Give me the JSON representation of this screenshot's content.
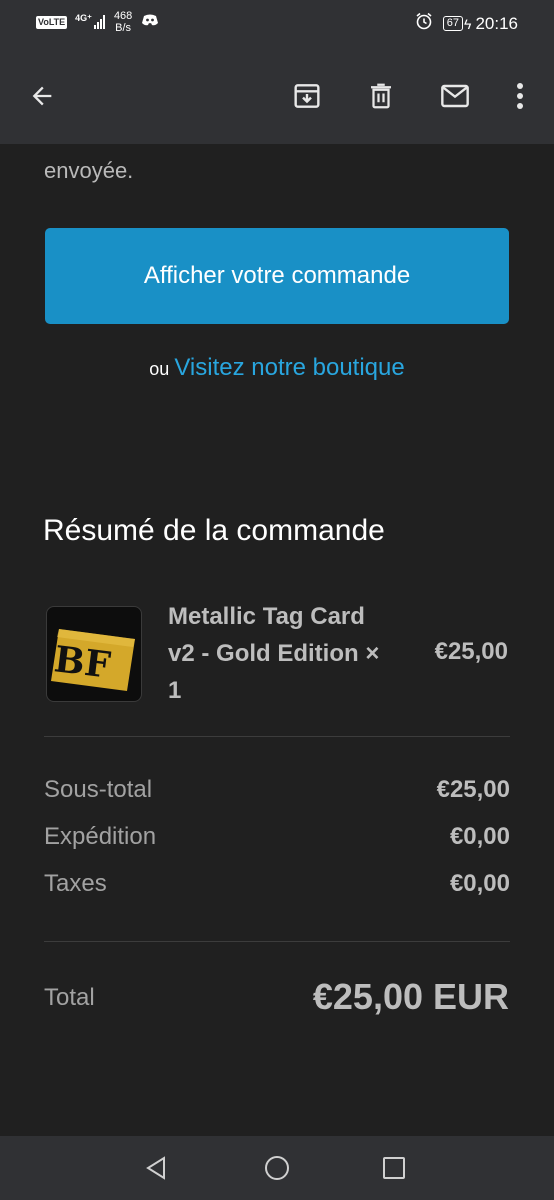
{
  "status_bar": {
    "network_badge": "VoLTE",
    "network_type": "4G⁺",
    "speed_value": "468",
    "speed_unit": "B/s",
    "battery": "67",
    "time": "20:16",
    "icons": [
      "discord-icon",
      "alarm-icon",
      "battery-icon",
      "charging-icon"
    ]
  },
  "toolbar": {
    "icons": [
      "back-arrow-icon",
      "archive-icon",
      "delete-icon",
      "mark-unread-icon",
      "more-options-icon"
    ]
  },
  "email": {
    "partial_text": "envoyée.",
    "view_order_button": "Afficher votre commande",
    "or_text": "ou",
    "shop_link": "Visitez notre boutique",
    "summary_title": "Résumé de la commande",
    "product": {
      "name": "Metallic Tag Card v2 - Gold Edition × 1",
      "price": "€25,00",
      "thumb_text": "BF",
      "thumb_color": "#d4a82a"
    },
    "totals": [
      {
        "label": "Sous-total",
        "value": "€25,00"
      },
      {
        "label": "Expédition",
        "value": "€0,00"
      },
      {
        "label": "Taxes",
        "value": "€0,00"
      }
    ],
    "total": {
      "label": "Total",
      "value": "€25,00 EUR"
    }
  },
  "colors": {
    "accent": "#1990c6",
    "link": "#29a6df",
    "background": "#202020",
    "bar": "#303134"
  },
  "nav_bar": {
    "icons": [
      "nav-back-icon",
      "nav-home-icon",
      "nav-recents-icon"
    ]
  }
}
